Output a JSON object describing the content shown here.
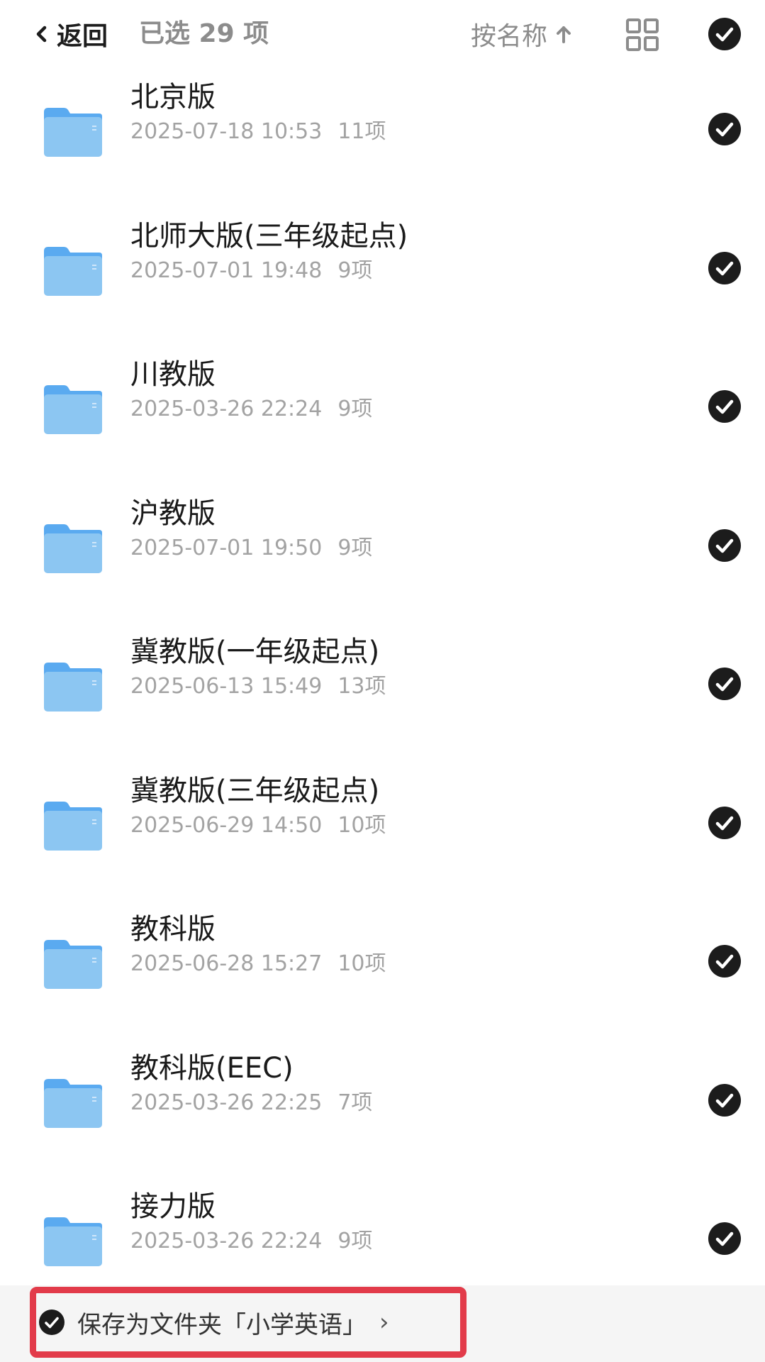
{
  "header": {
    "back_label": "返回",
    "selected_count": "已选 29 项",
    "sort_label": "按名称",
    "icons": {
      "back": "chevron-left-icon",
      "sort": "arrow-up-icon",
      "grid": "grid-view-icon",
      "select_all": "check-circle-icon"
    }
  },
  "folders": [
    {
      "name": "北京版",
      "date": "2025-07-18 10:53",
      "items": "11项"
    },
    {
      "name": "北师大版(三年级起点)",
      "date": "2025-07-01 19:48",
      "items": "9项"
    },
    {
      "name": "川教版",
      "date": "2025-03-26 22:24",
      "items": "9项"
    },
    {
      "name": "沪教版",
      "date": "2025-07-01 19:50",
      "items": "9项"
    },
    {
      "name": "冀教版(一年级起点)",
      "date": "2025-06-13 15:49",
      "items": "13项"
    },
    {
      "name": "冀教版(三年级起点)",
      "date": "2025-06-29 14:50",
      "items": "10项"
    },
    {
      "name": "教科版",
      "date": "2025-06-28 15:27",
      "items": "10项"
    },
    {
      "name": "教科版(EEC)",
      "date": "2025-03-26 22:25",
      "items": "7项"
    },
    {
      "name": "接力版",
      "date": "2025-03-26 22:24",
      "items": "9项"
    }
  ],
  "bottom": {
    "save_label": "保存为文件夹「小学英语」",
    "chevron": "›"
  },
  "colors": {
    "accent_highlight": "#e23b4a",
    "check_fill": "#1c1c1c",
    "folder_blue": "#8cc6f2",
    "muted_text": "#a3a3a3"
  }
}
